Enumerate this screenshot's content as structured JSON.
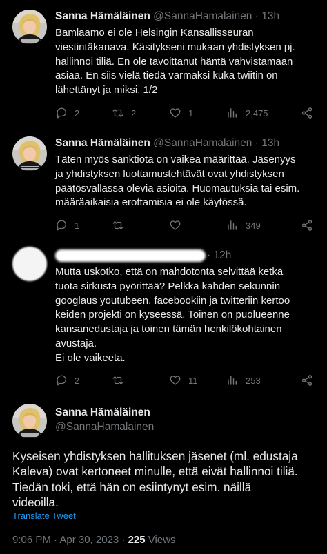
{
  "tweets": [
    {
      "name": "Sanna Hämäläinen",
      "handle": "@SannaHamalainen",
      "sep": "·",
      "time": "13h",
      "lines": [
        "Bamlaamo ei ole Helsingin Kansallisseuran",
        "viestintäkanava. Käsitykseni mukaan yhdistyksen pj.",
        "hallinnoi tiliä. En ole tavoittanut häntä vahvistamaan",
        "asiaa. En siis vielä tiedä varmaksi kuka twiitin on",
        "lähettänyt ja miksi. 1/2"
      ],
      "replies": "2",
      "retweets": "2",
      "likes": "1",
      "views": "2,475"
    },
    {
      "name": "Sanna Hämäläinen",
      "handle": "@SannaHamalainen",
      "sep": "·",
      "time": "13h",
      "lines": [
        "Täten myös sanktiota on vaikea määrittää. Jäsenyys",
        "ja yhdistyksen luottamustehtävät ovat yhdistyksen",
        "päätösvallassa olevia asioita. Huomautuksia tai esim.",
        "määräaikaisia erottamisia ei ole käytössä."
      ],
      "replies": "1",
      "retweets": "",
      "likes": "",
      "views": "349"
    },
    {
      "time": "12h",
      "sep": "·",
      "lines": [
        "Mutta uskotko, että on mahdotonta selvittää ketkä",
        "tuota sirkusta pyörittää? Pelkkä kahden sekunnin",
        "googlaus youtubeen, facebookiin ja twitteriin kertoo",
        "keiden projekti on kyseessä. Toinen on puolueenne",
        "kansanedustaja ja toinen tämän henkilökohtainen",
        "avustaja.",
        "Ei ole vaikeeta."
      ],
      "replies": "2",
      "retweets": "",
      "likes": "11",
      "views": "253"
    }
  ],
  "main": {
    "name": "Sanna Hämäläinen",
    "handle": "@SannaHamalainen",
    "lines": [
      "Kyseisen yhdistyksen hallituksen jäsenet (ml. edustaja",
      "Kaleva) ovat kertoneet minulle, että eivät hallinnoi tiliä.",
      "Tiedän toki, että hän on esiintynyt esim. näillä",
      "videoilla."
    ],
    "translate": "Translate Tweet",
    "timestamp": "9:06 PM · Apr 30, 2023 · ",
    "views_count": "225",
    "views_label": " Views"
  },
  "icons": {
    "reply": "reply-icon",
    "retweet": "retweet-icon",
    "like": "heart-icon",
    "views": "views-icon",
    "share": "share-icon"
  },
  "colors": {
    "background": "#000000",
    "text": "#e7e9ea",
    "muted": "#71767b",
    "link": "#1d9bf0"
  }
}
